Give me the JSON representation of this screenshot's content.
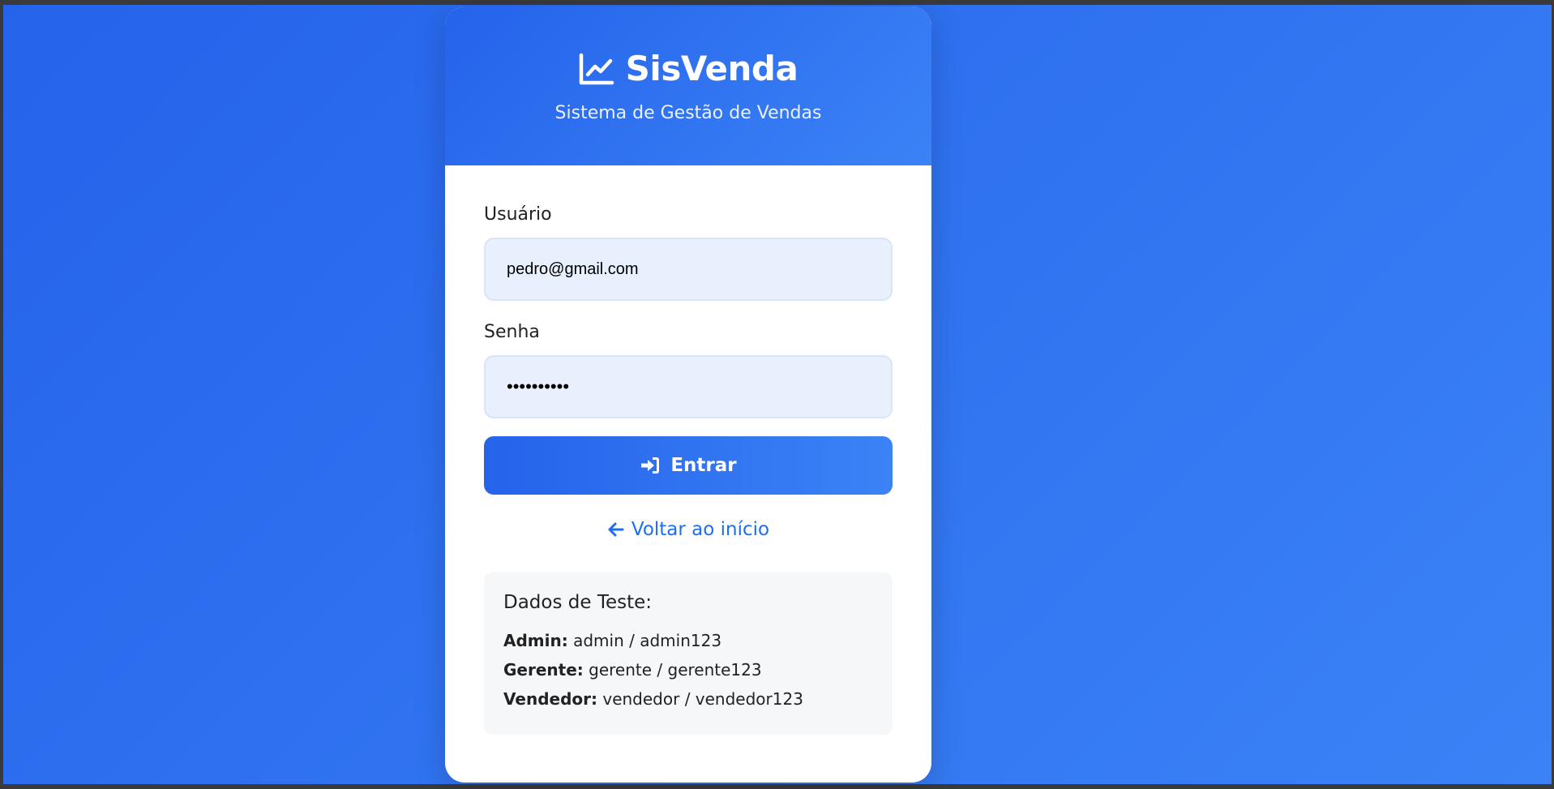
{
  "header": {
    "brand": "SisVenda",
    "brand_icon": "chart-line-icon",
    "subtitle": "Sistema de Gestão de Vendas"
  },
  "form": {
    "username_label": "Usuário",
    "username_value": "pedro@gmail.com",
    "password_label": "Senha",
    "password_value": "••••••••••",
    "submit_label": "Entrar",
    "submit_icon": "sign-in-icon",
    "back_label": "Voltar ao início",
    "back_icon": "arrow-left-icon"
  },
  "test_data": {
    "title": "Dados de Teste:",
    "entries": [
      {
        "role": "Admin:",
        "credentials": "admin / admin123"
      },
      {
        "role": "Gerente:",
        "credentials": "gerente / gerente123"
      },
      {
        "role": "Vendedor:",
        "credentials": "vendedor / vendedor123"
      }
    ]
  },
  "colors": {
    "primary": "#2563eb",
    "primary_light": "#3b82f6",
    "link": "#1d6ff2",
    "input_bg": "#e8f0fe"
  }
}
